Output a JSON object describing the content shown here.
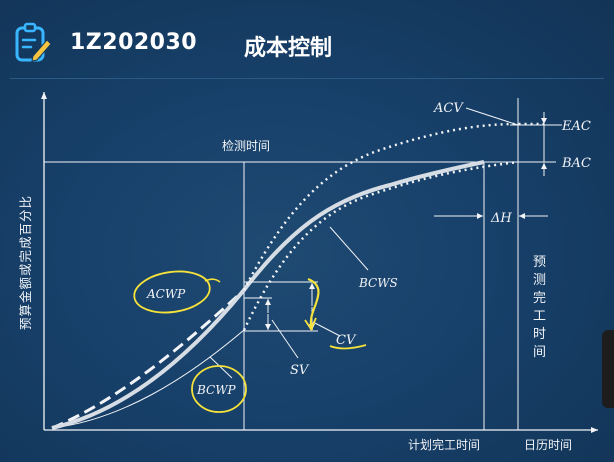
{
  "header": {
    "code": "1Z202030",
    "title": "成本控制",
    "icon": "notepad-pencil-icon"
  },
  "diagram": {
    "y_axis_label": "预算金额或完成百分比",
    "x_axis_label": "日历时间",
    "check_time_label": "检测时间",
    "planned_finish_label": "计划完工时间",
    "forecast_finish_label": [
      "预",
      "测",
      "完",
      "工",
      "时",
      "间"
    ],
    "labels": {
      "acv": "ACV",
      "eac": "EAC",
      "bac": "BAC",
      "delta_h": "ΔH",
      "bcws": "BCWS",
      "acwp": "ACWP",
      "bcwp": "BCWP",
      "sv": "SV",
      "cv": "CV"
    },
    "colors": {
      "background": "#17406a",
      "lines": "#f2f4f7",
      "highlight": "#f5e23a"
    }
  }
}
